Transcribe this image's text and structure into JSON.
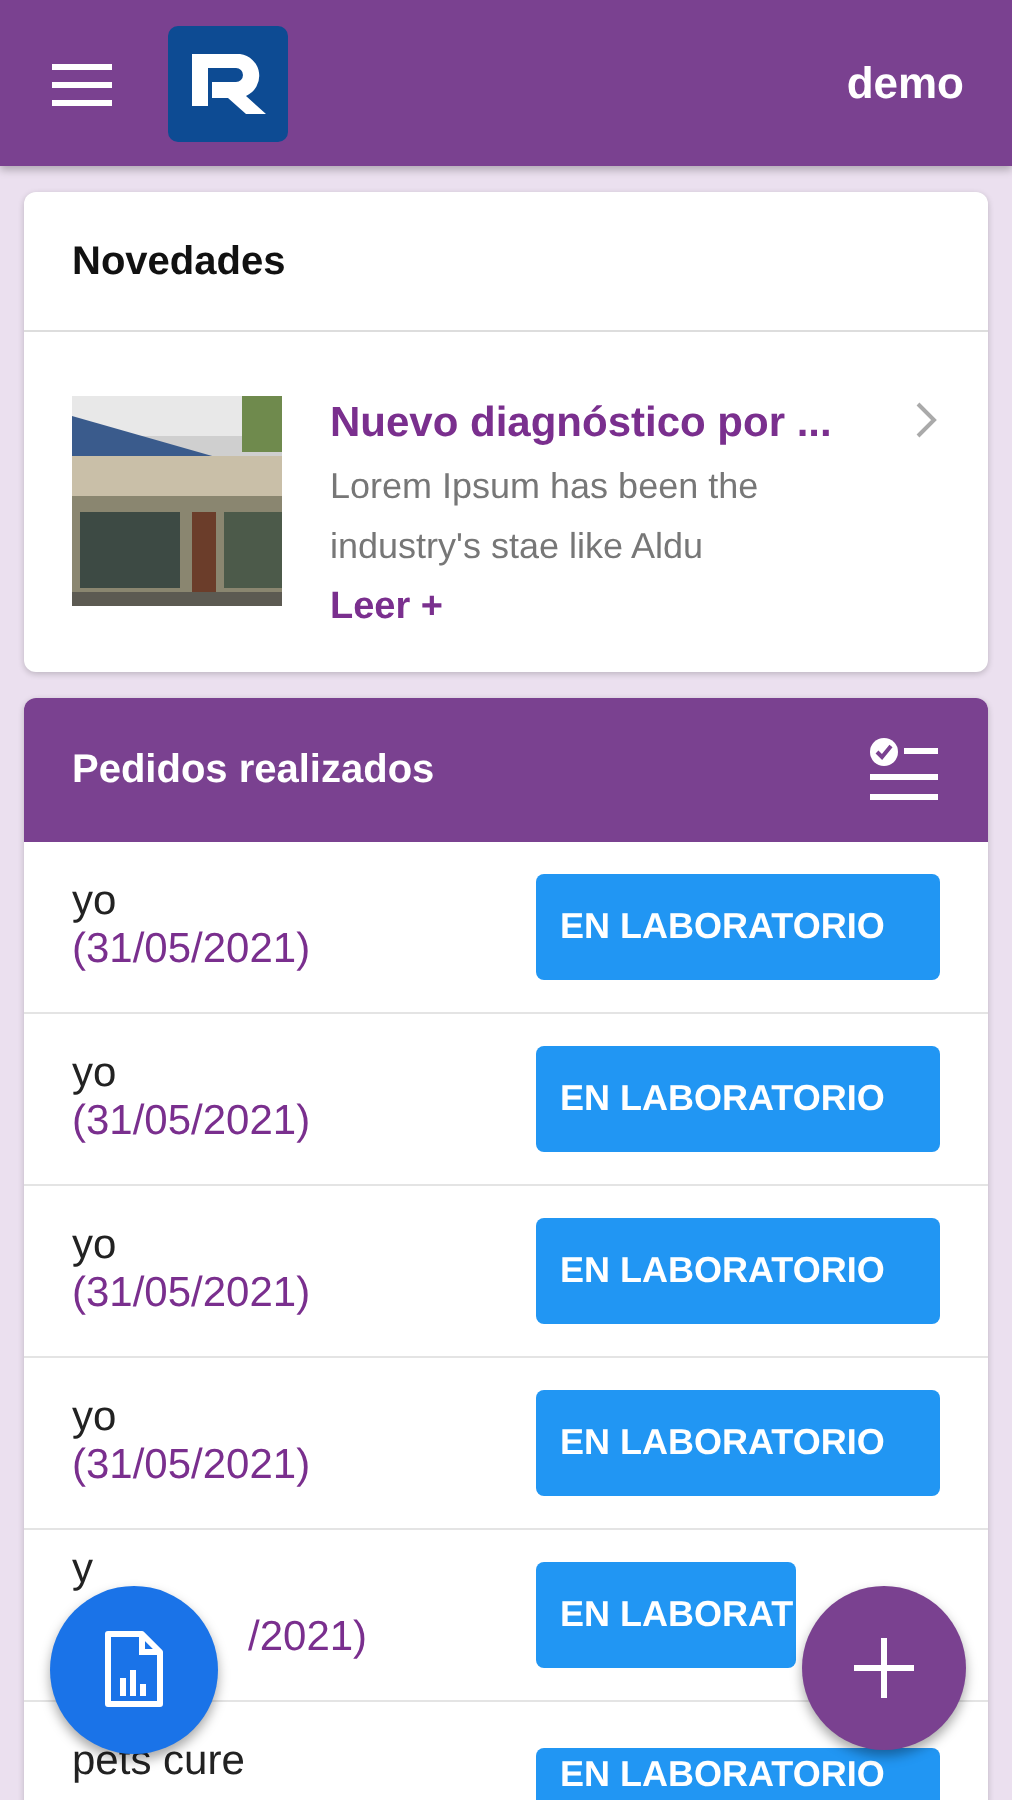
{
  "header": {
    "user": "demo"
  },
  "news": {
    "title": "Novedades",
    "items": [
      {
        "kind": "picture",
        "headline": "Nuevo diagnóstico por ...",
        "summary": "Lorem Ipsum has been the industry's stae like Aldu",
        "link": "Leer +"
      }
    ]
  },
  "orders": {
    "title": "Pedidos realizados",
    "rows": [
      {
        "kind": "full",
        "name": "yo",
        "date": "(31/05/2021)",
        "status": "EN LABORATORIO"
      },
      {
        "kind": "full",
        "name": "yo",
        "date": "(31/05/2021)",
        "status": "EN LABORATORIO"
      },
      {
        "kind": "full",
        "name": "yo",
        "date": "(31/05/2021)",
        "status": "EN LABORATORIO"
      },
      {
        "kind": "full",
        "name": "yo",
        "date": "(31/05/2021)",
        "status": "EN LABORATORIO"
      },
      {
        "kind": "partial",
        "name": "y",
        "date": "/2021)",
        "status": "EN LABORAT"
      },
      {
        "kind": "full",
        "name": "pets cure",
        "status": "EN LABORATORIO"
      }
    ]
  }
}
